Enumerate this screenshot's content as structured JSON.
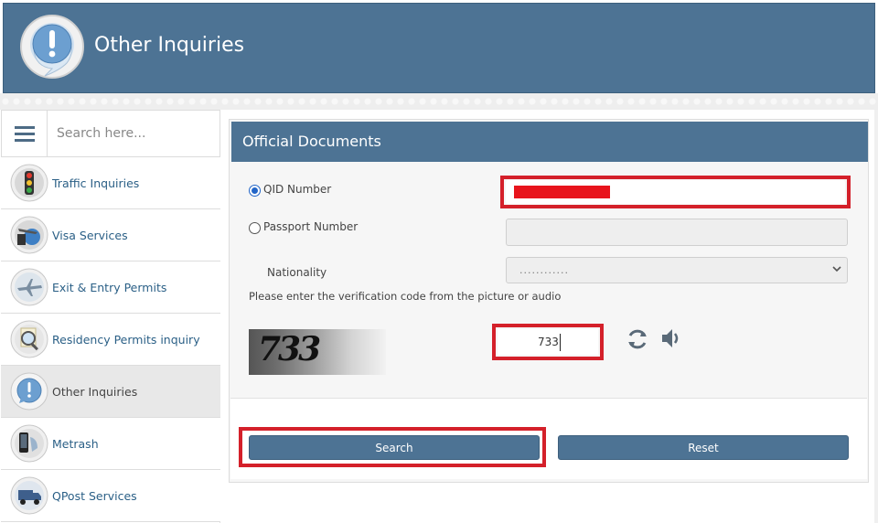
{
  "header": {
    "title": "Other Inquiries",
    "logo_icon": "exclamation-bubble-icon"
  },
  "sidebar": {
    "search_placeholder": "Search here...",
    "menu_icon": "hamburger-menu-icon",
    "items": [
      {
        "label": "Traffic Inquiries",
        "icon": "traffic-light-icon",
        "active": false
      },
      {
        "label": "Visa Services",
        "icon": "globe-plane-icon",
        "active": false
      },
      {
        "label": "Exit & Entry Permits",
        "icon": "airplane-icon",
        "active": false
      },
      {
        "label": "Residency Permits inquiry",
        "icon": "magnifier-icon",
        "active": false
      },
      {
        "label": "Other Inquiries",
        "icon": "exclamation-bubble-icon",
        "active": true
      },
      {
        "label": "Metrash",
        "icon": "phone-icon",
        "active": false
      },
      {
        "label": "QPost Services",
        "icon": "delivery-truck-icon",
        "active": false
      }
    ]
  },
  "panel": {
    "title": "Official Documents",
    "qid_label": "QID Number",
    "qid_selected": true,
    "passport_label": "Passport Number",
    "passport_selected": false,
    "nationality_label": "Nationality",
    "nationality_value": "............",
    "verification_prompt": "Please enter the verification code from the picture or audio",
    "captcha_text": "733",
    "code_value": "733",
    "refresh_icon": "refresh-icon",
    "audio_icon": "speaker-icon"
  },
  "buttons": {
    "search": "Search",
    "reset": "Reset"
  },
  "colors": {
    "header_bg": "#4d7394",
    "highlight": "#d4202a",
    "redaction": "#e8141c",
    "link": "#2a5f86"
  }
}
